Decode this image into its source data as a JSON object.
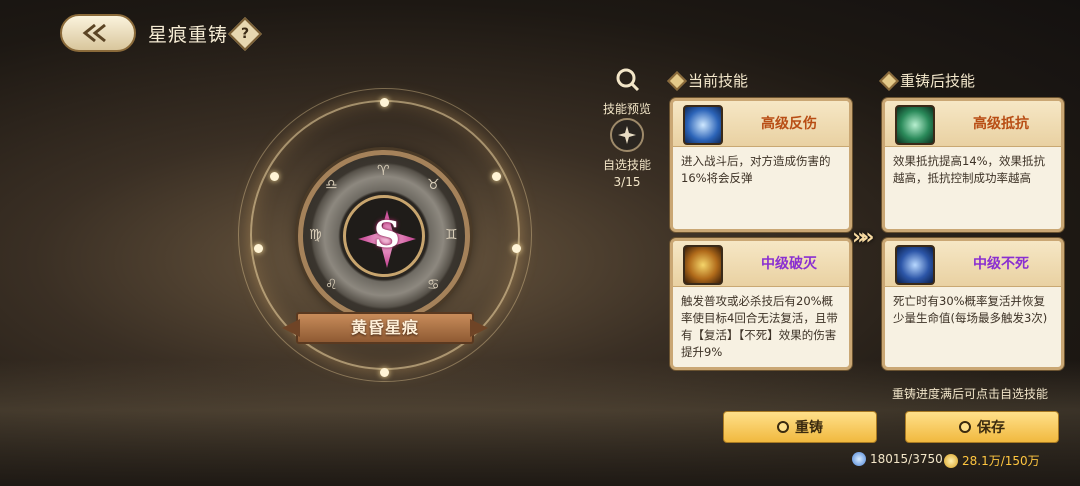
{
  "header": {
    "title": "星痕重铸",
    "help_label": "?"
  },
  "emblem": {
    "name": "黄昏星痕",
    "symbol": "S"
  },
  "side_buttons": {
    "preview_label": "技能预览",
    "select_label": "自选技能",
    "select_count": "3/15"
  },
  "current": {
    "heading": "当前技能",
    "skills": [
      {
        "name": "高级反伤",
        "desc": "进入战斗后，对方造成伤害的16%将会反弹",
        "color": "#b84d14",
        "icon": "shield-burst-icon"
      },
      {
        "name": "中级破灭",
        "desc": "触发普攻或必杀技后有20%概率使目标4回合无法复活，且带有【复活】【不死】效果的伤害提升9%",
        "color": "#8a2fd1",
        "icon": "skull-fire-icon"
      }
    ]
  },
  "recast": {
    "heading": "重铸后技能",
    "skills": [
      {
        "name": "高级抵抗",
        "desc": "效果抵抗提高14%，效果抵抗越高，抵抗控制成功率越高",
        "color": "#b84d14",
        "icon": "serpent-icon"
      },
      {
        "name": "中级不死",
        "desc": "死亡时有30%概率复活并恢复少量生命值(每场最多触发3次)",
        "color": "#8a2fd1",
        "icon": "eye-wings-icon"
      }
    ]
  },
  "arrow_glyph": "»»",
  "hint": "重铸进度满后可点击自选技能",
  "buttons": {
    "recast_label": "重铸",
    "save_label": "保存"
  },
  "resources": {
    "crystal": "18015/3750",
    "gold": "28.1万/150万"
  }
}
